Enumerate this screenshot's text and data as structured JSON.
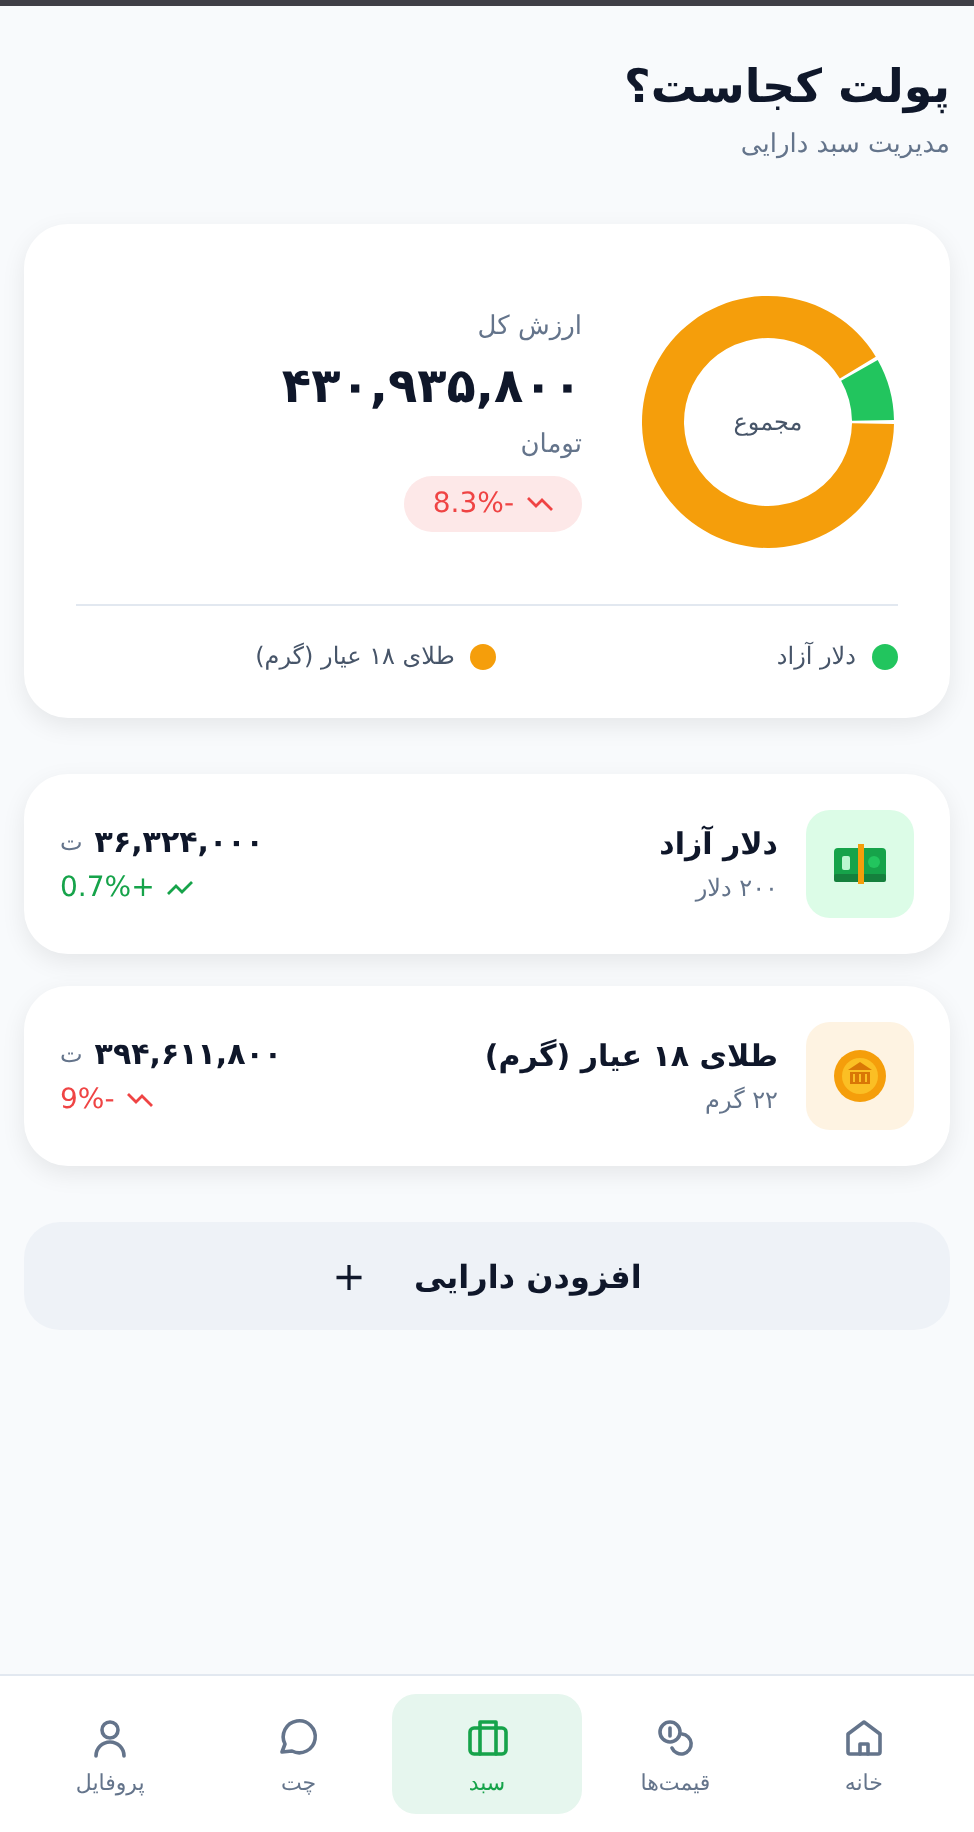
{
  "header": {
    "title": "پولت کجاست؟",
    "subtitle": "مدیریت سبد دارایی"
  },
  "summary": {
    "label": "ارزش کل",
    "total": "۴۳۰,۹۳۵,۸۰۰",
    "unit": "تومان",
    "change": {
      "text": "8.3%-",
      "rising": false
    },
    "center_label": "مجموع",
    "legend": [
      {
        "label": "دلار آزاد",
        "color": "#22c55e"
      },
      {
        "label": "طلای ۱۸ عیار (گرم)",
        "color": "#f59e0b"
      }
    ]
  },
  "assets": [
    {
      "kind": "cash",
      "name": "دلار آزاد",
      "amount": "۲۰۰ دلار",
      "value": "۳۶,۳۲۴,۰۰۰",
      "unit": "ت",
      "change": "0.7%+",
      "rising": true
    },
    {
      "kind": "gold",
      "name": "طلای ۱۸ عیار (گرم)",
      "amount": "۲۲ گرم",
      "value": "۳۹۴,۶۱۱,۸۰۰",
      "unit": "ت",
      "change": "9%-",
      "rising": false
    }
  ],
  "add_button": {
    "icon": "+",
    "label": "افزودن دارایی"
  },
  "nav": [
    {
      "label": "خانه",
      "selected": false
    },
    {
      "label": "قیمت‌ها",
      "selected": false
    },
    {
      "label": "سبد",
      "selected": true
    },
    {
      "label": "چت",
      "selected": false
    },
    {
      "label": "پروفایل",
      "selected": false
    }
  ]
}
